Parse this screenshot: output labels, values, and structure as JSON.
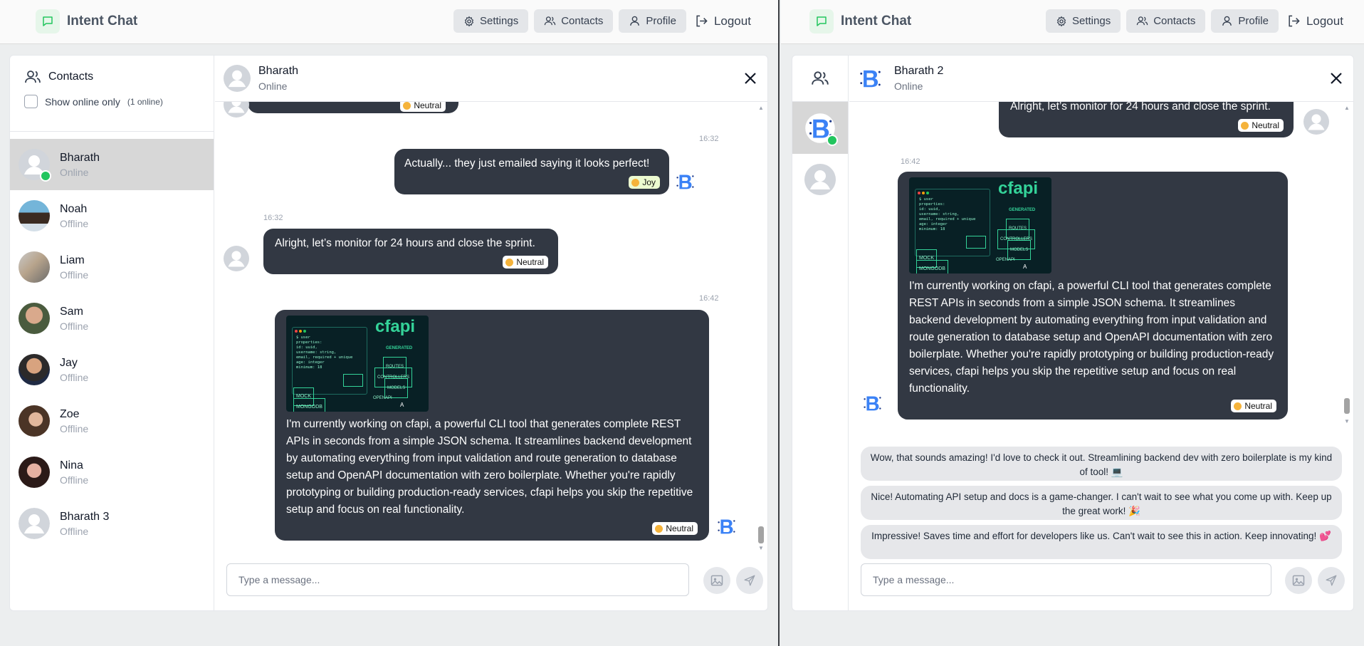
{
  "app": {
    "title": "Intent Chat"
  },
  "nav": {
    "settings": "Settings",
    "contacts": "Contacts",
    "profile": "Profile",
    "logout": "Logout"
  },
  "contacts": {
    "title": "Contacts",
    "online_toggle": "Show online only",
    "online_count": "(1 online)",
    "items": [
      {
        "name": "Bharath",
        "status": "Online"
      },
      {
        "name": "Noah",
        "status": "Offline"
      },
      {
        "name": "Liam",
        "status": "Offline"
      },
      {
        "name": "Sam",
        "status": "Offline"
      },
      {
        "name": "Jay",
        "status": "Offline"
      },
      {
        "name": "Zoe",
        "status": "Offline"
      },
      {
        "name": "Nina",
        "status": "Offline"
      },
      {
        "name": "Bharath 3",
        "status": "Offline"
      }
    ]
  },
  "left_chat": {
    "name": "Bharath",
    "status": "Online",
    "messages": [
      {
        "mood": "Neutral"
      },
      {
        "time": "16:32",
        "text": "Actually... they just emailed saying it looks perfect!",
        "mood": "Joy"
      },
      {
        "time": "16:32",
        "text": "Alright, let’s monitor for 24 hours and close the sprint.",
        "mood": "Neutral"
      },
      {
        "time": "16:42",
        "text": "I'm currently working on cfapi, a powerful CLI tool that generates complete REST APIs in seconds from a simple JSON schema. It streamlines backend development by automating everything from input validation and route generation to database setup and OpenAPI documentation with zero boilerplate. Whether you're rapidly prototyping or building production-ready services, cfapi helps you skip the repetitive setup and focus on real functionality.",
        "mood": "Neutral"
      }
    ],
    "input_placeholder": "Type a message..."
  },
  "right_chat": {
    "name": "Bharath 2",
    "status": "Online",
    "messages": [
      {
        "text": "Alright, let’s monitor for 24 hours and close the sprint.",
        "mood": "Neutral"
      },
      {
        "time": "16:42",
        "text": "I'm currently working on cfapi, a powerful CLI tool that generates complete REST APIs in seconds from a simple JSON schema. It streamlines backend development by automating everything from input validation and route generation to database setup and OpenAPI documentation with zero boilerplate. Whether you're rapidly prototyping or building production-ready services, cfapi helps you skip the repetitive setup and focus on real functionality.",
        "mood": "Neutral"
      }
    ],
    "suggestions": [
      "Wow, that sounds amazing! I'd love to check it out. Streamlining backend dev with zero boilerplate is my kind of tool! 💻",
      "Nice! Automating API setup and docs is a game-changer. I can't wait to see what you come up with. Keep up the great work! 🎉",
      "Impressive! Saves time and effort for developers like us. Can't wait to see this in action. Keep innovating! 💕"
    ],
    "input_placeholder": "Type a message..."
  },
  "image_card": {
    "brand": "cfapi",
    "generated": "GENERATED",
    "code": [
      "$ user",
      "  properties:",
      "    id: uuid,",
      "    username: string,",
      "    email, required + unique",
      "    age: integer",
      "    minimum: 18"
    ],
    "tags": [
      "ROUTES",
      "CONTROLLERS",
      "MODELS",
      "OPENAPI"
    ],
    "db": [
      "MOCK",
      "MONGODB"
    ],
    "corner": "A"
  },
  "colors": {
    "bubble": "#323843",
    "online": "#22c55e",
    "accent_logo": "#3b82f6",
    "image_teal": "#34d399"
  }
}
